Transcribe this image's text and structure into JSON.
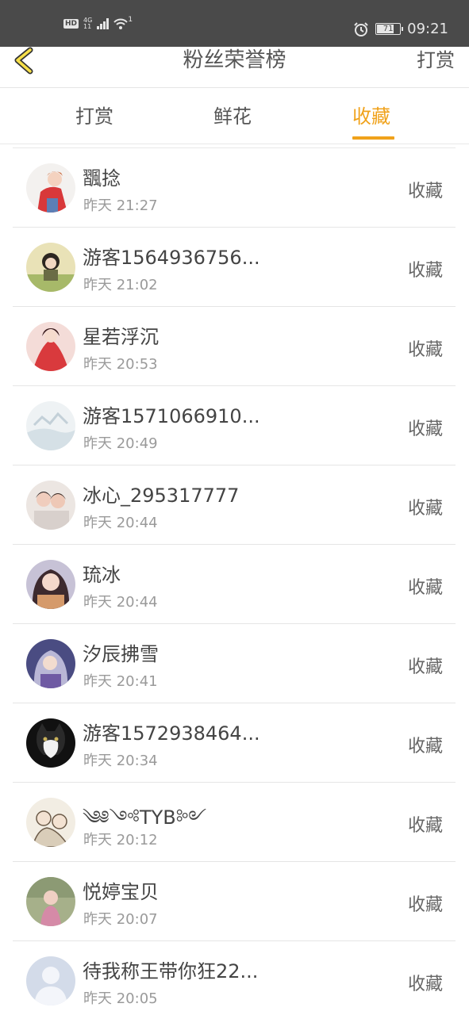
{
  "status_bar": {
    "hd": "HD",
    "net_type": "4G",
    "net_sub": "11",
    "wifi_sup": "1",
    "battery": "71",
    "time": "09:21"
  },
  "nav": {
    "title": "粉丝荣誉榜",
    "right_label": "打赏",
    "back_icon": "chevron-left-icon",
    "accent_color": "#f0a21b"
  },
  "tabs": [
    {
      "label": "打赏",
      "active": false
    },
    {
      "label": "鲜花",
      "active": false
    },
    {
      "label": "收藏",
      "active": true
    }
  ],
  "fans": [
    {
      "name": "飁捻",
      "time": "昨天 21:27",
      "action": "收藏"
    },
    {
      "name": "游客1564936756...",
      "time": "昨天 21:02",
      "action": "收藏"
    },
    {
      "name": "星若浮沉",
      "time": "昨天 20:53",
      "action": "收藏"
    },
    {
      "name": "游客1571066910...",
      "time": "昨天 20:49",
      "action": "收藏"
    },
    {
      "name": "冰心_295317777",
      "time": "昨天 20:44",
      "action": "收藏"
    },
    {
      "name": "琉冰",
      "time": "昨天 20:44",
      "action": "收藏"
    },
    {
      "name": "汐辰拂雪",
      "time": "昨天 20:41",
      "action": "收藏"
    },
    {
      "name": "游客1572938464...",
      "time": "昨天 20:34",
      "action": "收藏"
    },
    {
      "name": "༄༅༺TYB༻",
      "time": "昨天 20:12",
      "action": "收藏"
    },
    {
      "name": "悦婷宝贝",
      "time": "昨天 20:07",
      "action": "收藏"
    },
    {
      "name": "待我称王带你狂22...",
      "time": "昨天 20:05",
      "action": "收藏"
    }
  ]
}
